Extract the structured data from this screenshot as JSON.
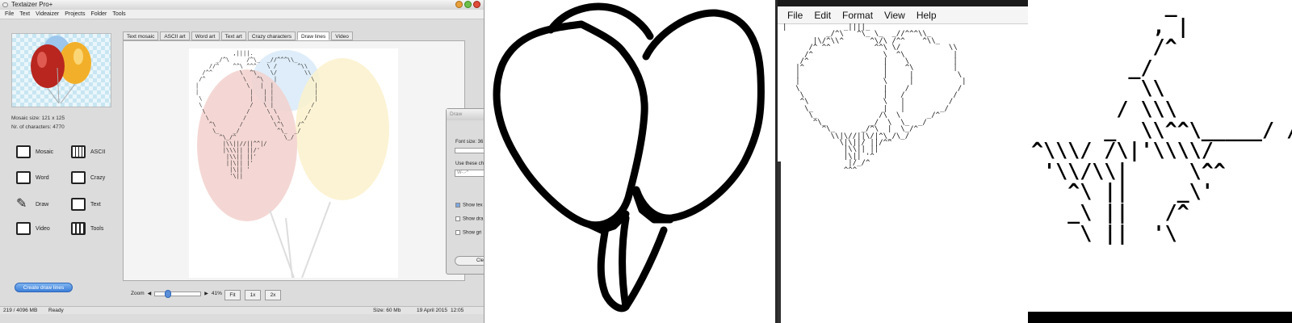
{
  "app": {
    "title": "Textaizer Pro+",
    "menu": [
      "File",
      "Text",
      "Videaizer",
      "Projects",
      "Folder",
      "Tools"
    ],
    "mosaic_size": "Mosaic size: 121 x 125",
    "char_count": "Nr. of characters: 4770",
    "tools": [
      "Mosaic",
      "ASCII",
      "Word",
      "Crazy",
      "Draw",
      "Text",
      "Video",
      "Tools"
    ],
    "create_button": "Create draw lines",
    "tabs": [
      "Text mosaic",
      "ASCII art",
      "Word art",
      "Text art",
      "Crazy characters",
      "Draw lines",
      "Video"
    ],
    "active_tab": "Draw lines",
    "zoom_label": "Zoom",
    "zoom_value": "41%",
    "zoom_buttons": [
      "Fit",
      "1x",
      "2x"
    ],
    "status": {
      "memory": "219 / 4096 MB",
      "state": "Ready",
      "size": "Size: 60 Mb",
      "date": "19 April 2015",
      "time": "12:05"
    },
    "dialog": {
      "title": "Draw",
      "font_size": "Font size: 36",
      "use_chars": "Use these ch",
      "chars_value": "W-.-^",
      "show1": "Show tex",
      "show2": "Show dra",
      "show3": "Show gri",
      "clear": "Clea"
    },
    "colors": {
      "accent": "#3c7fd9",
      "window_bg": "#dcdcdc"
    }
  },
  "notepad": {
    "menu": [
      "File",
      "Edit",
      "Format",
      "View",
      "Help"
    ]
  }
}
